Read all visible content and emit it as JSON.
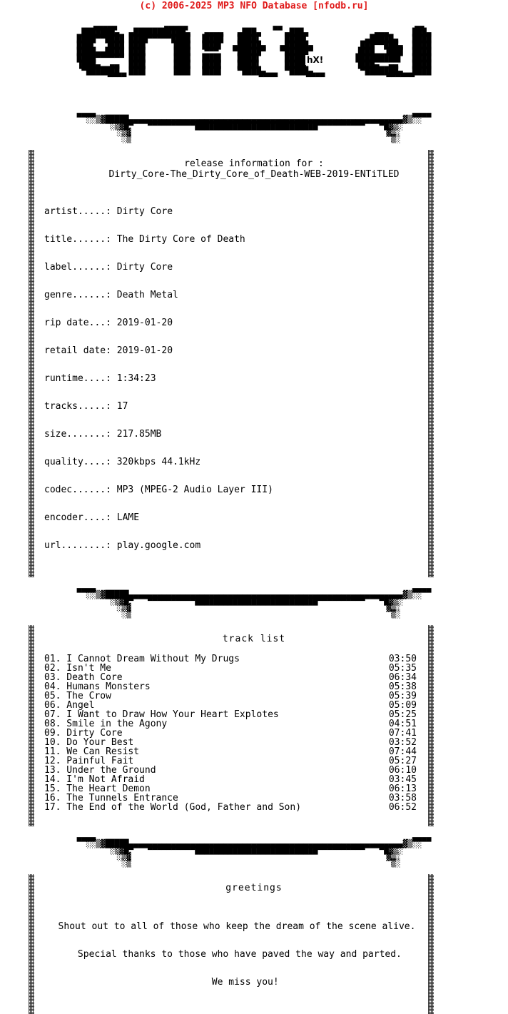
{
  "header": {
    "copyright": "(c) 2006-2025 MP3 NFO Database [nfodb.ru]",
    "copyright_color": "#E01B1B"
  },
  "logo": {
    "group_name": "entitled",
    "artist_tag": "hX!",
    "art": "  ▄▄▄▄▄          ▄▄▄▄▄                  ▄▄                            ▄▄\n ███████▄  ▄███████████▄   ▄▄▄▄   ▄███▄     ▄███▄              ▄▄▄     ███▄\n████▀▀████ ████▀▀▀▀▀████  ▐████   ████▌     ████▌            ▄█████▄   ████\n███▌  ▐███ ███▌     ▐███  ▐███▌  ▄█████▄   ▄█████▄          ███▀▀███▄  ████\n████▄▄████ ███▌     ▐███   ▀▀▀   ▀█████▀   ▀█████▀         ▐███  ▐███  ████\n████▀▀▀▀▀▀ ███▌     ▐███  ▐███▌   ████▌     ████▌          █████████▌  ████\n▐███▄  ▄▄  ███▌     ▐███  ▐███▌   ████▌     ████▌          ▐███▄  ▄▄   ████\n ▀███████  ███▌     ▐███  ▐███▌   ▀████▄    ▀████▄          ▀███████▄  ████\n   ▀▀▀▀                            ▀▀▀▀      ▀▀▀▀             ▀▀▀▀▀▀"
  },
  "separator": {
    "art": "▄▄▄▄                                                                   ▄▄▄▄\n░░▒▓█████▄▄▄▄▄▄▄▄▄▄▄▄▄▄▄▄▄▄▄▄▄▄▄▄▄▄▄▄▄▄▄▄▄▄▄▄▄▄▄▄▄▄▄▄▄▄▄▄▄▄▄▄▄▄▄▄▄▄▓▒░░\n ░▒▓█▀   ▀▀▀▀▀▀▀▀▀▀██████████████████████████▀▀▀▀▀▀▀▀▀▀   ▀█▓▒░\n  ░▒▓                                                      ▓▒░\n   ░▒                                                       ▒░"
  },
  "release": {
    "heading": "release information for :",
    "release_name": "Dirty_Core-The_Dirty_Core_of_Death-WEB-2019-ENTiTLED",
    "fields": [
      {
        "label": "artist.....:",
        "value": "Dirty Core"
      },
      {
        "label": "title......:",
        "value": "The Dirty Core of Death"
      },
      {
        "label": "label......:",
        "value": "Dirty Core"
      },
      {
        "label": "genre......:",
        "value": "Death Metal"
      },
      {
        "label": "rip date...:",
        "value": "2019-01-20"
      },
      {
        "label": "retail date:",
        "value": "2019-01-20"
      },
      {
        "label": "runtime....:",
        "value": "1:34:23"
      },
      {
        "label": "tracks.....:",
        "value": "17"
      },
      {
        "label": "size.......:",
        "value": "217.85MB"
      },
      {
        "label": "quality....:",
        "value": "320kbps 44.1kHz"
      },
      {
        "label": "codec......:",
        "value": "MP3 (MPEG-2 Audio Layer III)"
      },
      {
        "label": "encoder....:",
        "value": "LAME"
      },
      {
        "label": "url........:",
        "value": "play.google.com"
      }
    ]
  },
  "tracklist": {
    "heading": "track list",
    "tracks": [
      {
        "name": "01. I Cannot Dream Without My Drugs",
        "time": "03:50"
      },
      {
        "name": "02. Isn't Me",
        "time": "05:35"
      },
      {
        "name": "03. Death Core",
        "time": "06:34"
      },
      {
        "name": "04. Humans Monsters",
        "time": "05:38"
      },
      {
        "name": "05. The Crow",
        "time": "05:39"
      },
      {
        "name": "06. Angel",
        "time": "05:09"
      },
      {
        "name": "07. I Want to Draw How Your Heart Explotes",
        "time": "05:25"
      },
      {
        "name": "08. Smile in the Agony",
        "time": "04:51"
      },
      {
        "name": "09. Dirty Core",
        "time": "07:41"
      },
      {
        "name": "10. Do Your Best",
        "time": "03:52"
      },
      {
        "name": "11. We Can Resist",
        "time": "07:44"
      },
      {
        "name": "12. Painful Fait",
        "time": "05:27"
      },
      {
        "name": "13. Under the Ground",
        "time": "06:10"
      },
      {
        "name": "14. I'm Not Afraid",
        "time": "03:45"
      },
      {
        "name": "15. The Heart Demon",
        "time": "06:13"
      },
      {
        "name": "16. The Tunnels Entrance",
        "time": "03:58"
      },
      {
        "name": "17. The End of the World (God, Father and Son)",
        "time": "06:52"
      }
    ]
  },
  "greetings": {
    "heading": "greetings",
    "lines": [
      "Shout out to all of those who keep the dream of the scene alive.",
      " Special thanks to those who have paved the way and parted.",
      "   We miss you!"
    ]
  }
}
